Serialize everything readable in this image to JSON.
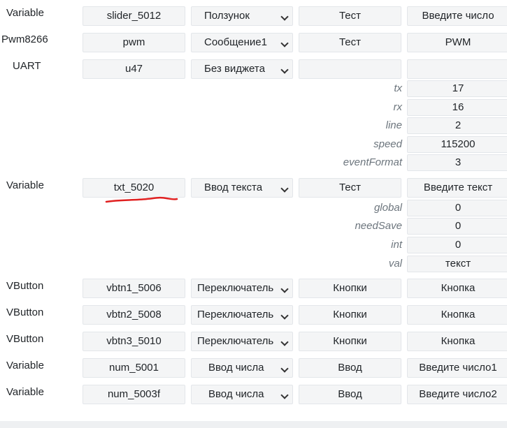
{
  "rows": [
    {
      "type": "Variable",
      "id": "slider_5012",
      "widget": "Ползунок",
      "page": "Тест",
      "descr": "Введите число"
    },
    {
      "type": "Pwm8266",
      "id": "pwm",
      "widget": "Сообщение1",
      "page": "Тест",
      "descr": "PWM"
    },
    {
      "type": "UART",
      "id": "u47",
      "widget": "Без виджета",
      "page": "",
      "descr": ""
    },
    {
      "type": "Variable",
      "id": "txt_5020",
      "widget": "Ввод текста",
      "page": "Тест",
      "descr": "Введите текст"
    },
    {
      "type": "VButton",
      "id": "vbtn1_5006",
      "widget": "Переключатель",
      "page": "Кнопки",
      "descr": "Кнопка"
    },
    {
      "type": "VButton",
      "id": "vbtn2_5008",
      "widget": "Переключатель",
      "page": "Кнопки",
      "descr": "Кнопка"
    },
    {
      "type": "VButton",
      "id": "vbtn3_5010",
      "widget": "Переключатель",
      "page": "Кнопки",
      "descr": "Кнопка"
    },
    {
      "type": "Variable",
      "id": "num_5001",
      "widget": "Ввод числа",
      "page": "Ввод",
      "descr": "Введите число1"
    },
    {
      "type": "Variable",
      "id": "num_5003f",
      "widget": "Ввод числа",
      "page": "Ввод",
      "descr": "Введите число2"
    }
  ],
  "uart_params": [
    {
      "key": "tx",
      "value": "17"
    },
    {
      "key": "rx",
      "value": "16"
    },
    {
      "key": "line",
      "value": "2"
    },
    {
      "key": "speed",
      "value": "115200"
    },
    {
      "key": "eventFormat",
      "value": "3"
    }
  ],
  "txt_params": [
    {
      "key": "global",
      "value": "0"
    },
    {
      "key": "needSave",
      "value": "0"
    },
    {
      "key": "int",
      "value": "0"
    },
    {
      "key": "val",
      "value": "текст"
    }
  ],
  "annotation_color": "#e02020"
}
